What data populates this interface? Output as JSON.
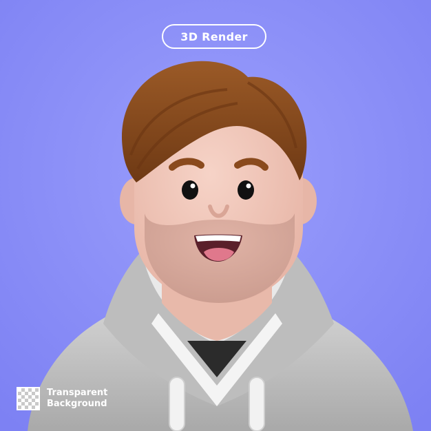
{
  "badge_top": {
    "label": "3D Render"
  },
  "badge_bottom": {
    "line1": "Transparent",
    "line2": "Background"
  },
  "colors": {
    "background": "#8c90fa",
    "skin": "#f2c6b8",
    "beard": "#d7a89b",
    "hair": "#8a4a1d",
    "hoodie": "#c9c9c9",
    "shirt": "#2b2b2b",
    "white": "#ffffff"
  },
  "illustration": {
    "subject": "3d-avatar-man-with-hoodie"
  }
}
